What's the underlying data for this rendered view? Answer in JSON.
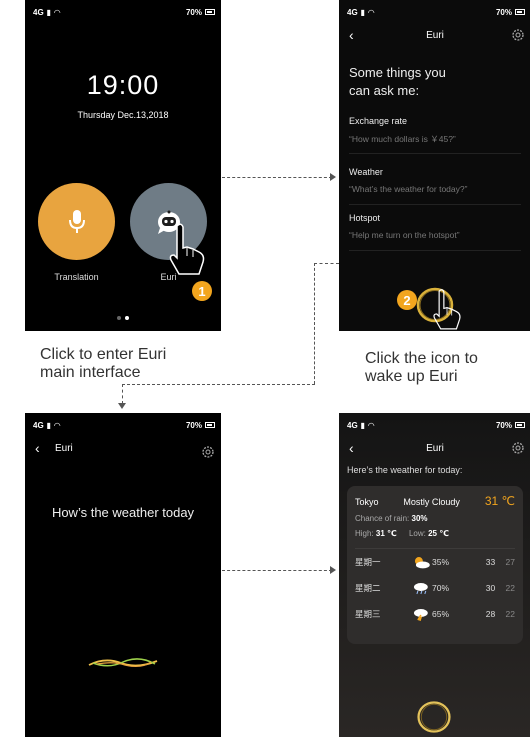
{
  "status": {
    "network": "4G",
    "battery": "70%"
  },
  "home": {
    "time": "19:00",
    "date": "Thursday Dec.13,2018",
    "apps": [
      {
        "label": "Translation"
      },
      {
        "label": "Euri"
      }
    ],
    "step_badge": "1"
  },
  "suggestions_screen": {
    "title": "Euri",
    "heading_line1": "Some things you",
    "heading_line2": "can ask me:",
    "items": [
      {
        "topic": "Exchange rate",
        "example": "“How much dollars is ￥45?”"
      },
      {
        "topic": "Weather",
        "example": "“What’s the weather for today?”"
      },
      {
        "topic": "Hotspot",
        "example": "“Help me turn on the hotspot”"
      }
    ],
    "step_badge": "2"
  },
  "captions": {
    "step1_line1": "Click to enter Euri",
    "step1_line2": "main interface",
    "step2_line1": "Click the icon to",
    "step2_line2": "wake up Euri"
  },
  "listening_screen": {
    "title": "Euri",
    "query": "How’s the weather today"
  },
  "weather_screen": {
    "title": "Euri",
    "intro": "Here’s the weather for today:",
    "city": "Tokyo",
    "condition": "Mostly Cloudy",
    "temp": "31 ℃",
    "rain_label": "Chance of rain:",
    "rain_value": "30%",
    "high_label": "High:",
    "high_value": "31 ℃",
    "low_label": "Low:",
    "low_value": "25 ℃",
    "forecast": [
      {
        "day": "星期一",
        "icon": "partly-cloudy-icon",
        "rain": "35%",
        "high": "33",
        "low": "27"
      },
      {
        "day": "星期二",
        "icon": "rain-icon",
        "rain": "70%",
        "high": "30",
        "low": "22"
      },
      {
        "day": "星期三",
        "icon": "thunderstorm-icon",
        "rain": "65%",
        "high": "28",
        "low": "22"
      }
    ]
  },
  "colors": {
    "accent": "#f2a51e",
    "translation_button": "#e8a43f",
    "euri_button": "#6f7c86"
  }
}
